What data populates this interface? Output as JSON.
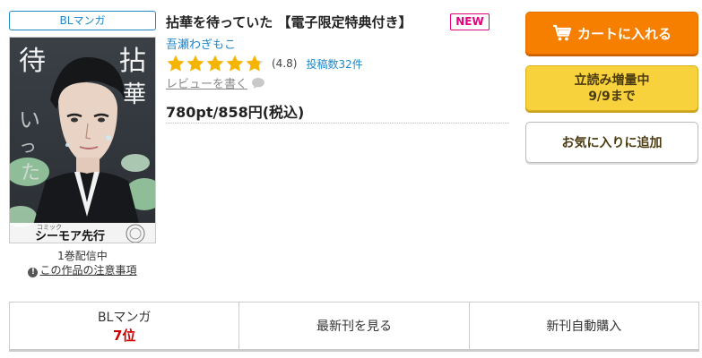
{
  "product": {
    "category_badge": "BLマンガ",
    "title": "拈華を待っていた 【電子限定特典付き】",
    "new_badge": "NEW",
    "author": "吾瀬わぎもこ",
    "rating_value": "(4.8)",
    "rating_score": 4.8,
    "review_count": "投稿数32件",
    "write_review": "レビューを書く",
    "price": "780pt/858円(税込)",
    "volume_status": "1巻配信中",
    "notice_link": "この作品の注意事項",
    "cover": {
      "title_glyphs": [
        "待",
        "拈",
        "華",
        "い",
        "っ",
        "た"
      ],
      "label_text": "シーモア先行",
      "label_small": "コミック"
    }
  },
  "actions": {
    "cart_label": "カートに入れる",
    "trial_line1": "立読み増量中",
    "trial_line2": "9/9まで",
    "favorite_label": "お気に入りに追加"
  },
  "tabs": {
    "ranking_label": "BLマンガ",
    "ranking_value": "7位",
    "latest_label": "最新刊を見る",
    "auto_purchase_label": "新刊自動購入"
  },
  "colors": {
    "accent_blue": "#1f87c8",
    "new_pink": "#e5007f",
    "cart_orange": "#f77f00",
    "trial_yellow": "#f8d23c",
    "star_gold": "#f5b400",
    "rank_red": "#cc0000"
  }
}
